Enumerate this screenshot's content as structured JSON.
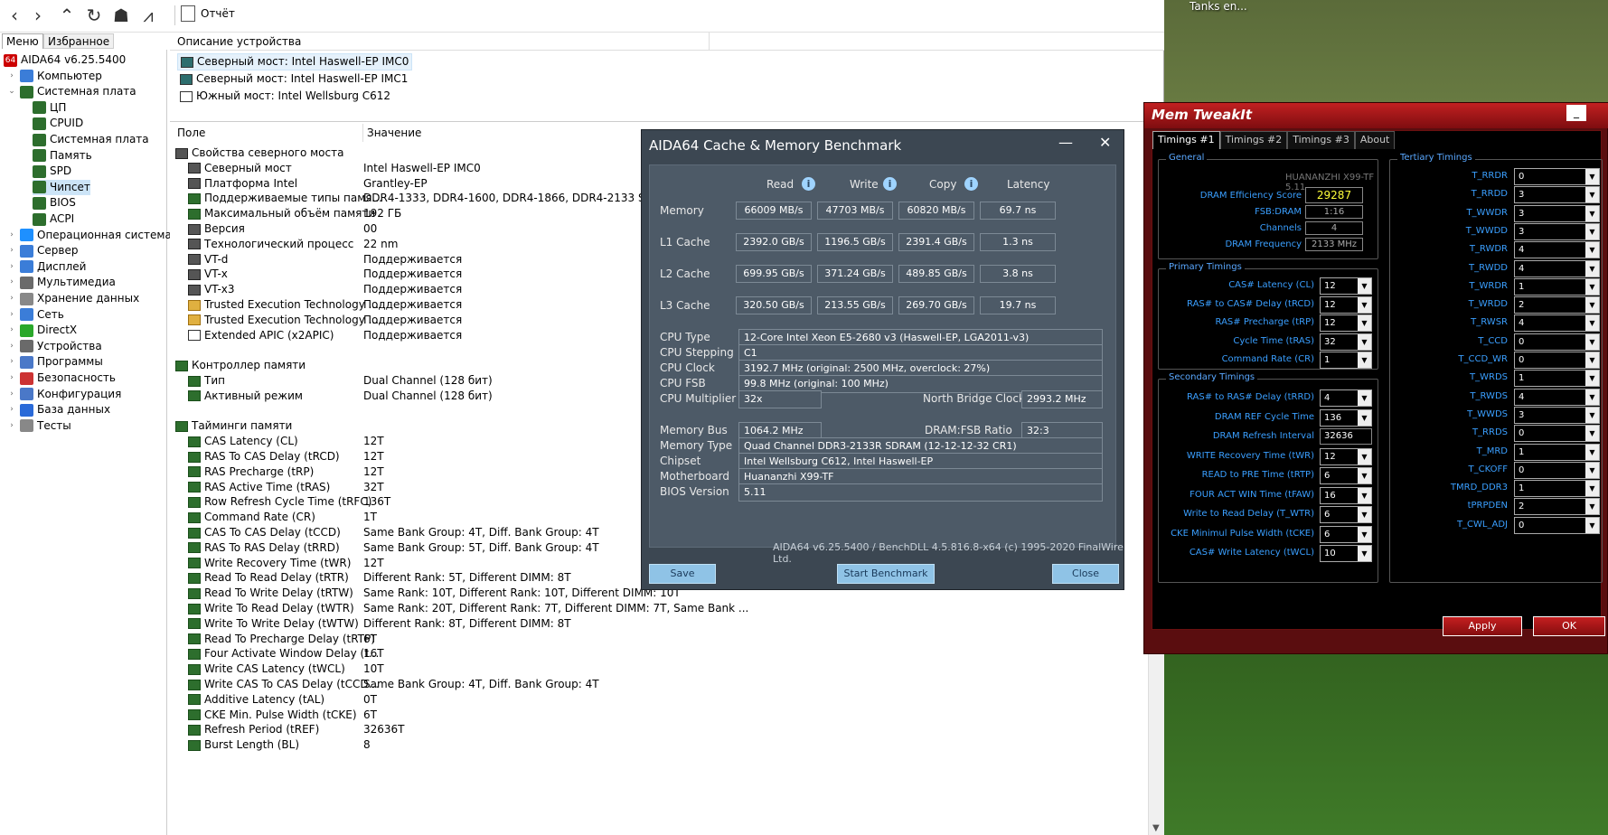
{
  "desktop": {
    "icon_label": "Tanks en..."
  },
  "toolbar": {
    "report_label": "Отчёт"
  },
  "tabs": {
    "menu": "Меню",
    "favorites": "Избранное"
  },
  "tree": [
    {
      "label": "AIDA64 v6.25.5400",
      "level": 0,
      "arrow": "",
      "icon": "aida64-icon"
    },
    {
      "label": "Компьютер",
      "level": 1,
      "arrow": "›",
      "icon": "computer-icon"
    },
    {
      "label": "Системная плата",
      "level": 1,
      "arrow": "⌄",
      "icon": "motherboard-icon"
    },
    {
      "label": "ЦП",
      "level": 2,
      "arrow": "",
      "icon": "cpu-icon"
    },
    {
      "label": "CPUID",
      "level": 2,
      "arrow": "",
      "icon": "cpuid-icon"
    },
    {
      "label": "Системная плата",
      "level": 2,
      "arrow": "",
      "icon": "board-icon"
    },
    {
      "label": "Память",
      "level": 2,
      "arrow": "",
      "icon": "memory-icon"
    },
    {
      "label": "SPD",
      "level": 2,
      "arrow": "",
      "icon": "spd-icon"
    },
    {
      "label": "Чипсет",
      "level": 2,
      "arrow": "",
      "icon": "chipset-icon",
      "selected": true
    },
    {
      "label": "BIOS",
      "level": 2,
      "arrow": "",
      "icon": "bios-icon"
    },
    {
      "label": "ACPI",
      "level": 2,
      "arrow": "",
      "icon": "acpi-icon"
    },
    {
      "label": "Операционная система",
      "level": 1,
      "arrow": "›",
      "icon": "os-icon"
    },
    {
      "label": "Сервер",
      "level": 1,
      "arrow": "›",
      "icon": "server-icon"
    },
    {
      "label": "Дисплей",
      "level": 1,
      "arrow": "›",
      "icon": "display-icon"
    },
    {
      "label": "Мультимедиа",
      "level": 1,
      "arrow": "›",
      "icon": "multimedia-icon"
    },
    {
      "label": "Хранение данных",
      "level": 1,
      "arrow": "›",
      "icon": "storage-icon"
    },
    {
      "label": "Сеть",
      "level": 1,
      "arrow": "›",
      "icon": "network-icon"
    },
    {
      "label": "DirectX",
      "level": 1,
      "arrow": "›",
      "icon": "directx-icon"
    },
    {
      "label": "Устройства",
      "level": 1,
      "arrow": "›",
      "icon": "devices-icon"
    },
    {
      "label": "Программы",
      "level": 1,
      "arrow": "›",
      "icon": "programs-icon"
    },
    {
      "label": "Безопасность",
      "level": 1,
      "arrow": "›",
      "icon": "security-icon"
    },
    {
      "label": "Конфигурация",
      "level": 1,
      "arrow": "›",
      "icon": "config-icon"
    },
    {
      "label": "База данных",
      "level": 1,
      "arrow": "›",
      "icon": "database-icon"
    },
    {
      "label": "Тесты",
      "level": 1,
      "arrow": "›",
      "icon": "tests-icon"
    }
  ],
  "device_header": "Описание устройства",
  "devices": [
    {
      "label": "Северный мост: Intel Haswell-EP IMC0",
      "selected": true
    },
    {
      "label": "Северный мост: Intel Haswell-EP IMC1"
    },
    {
      "label": "Южный мост: Intel Wellsburg C612"
    }
  ],
  "grid_headers": {
    "field": "Поле",
    "value": "Значение"
  },
  "rows": [
    {
      "field": "Свойства северного моста",
      "value": "",
      "group": true,
      "icon": "cpu"
    },
    {
      "field": "Северный мост",
      "value": "Intel Haswell-EP IMC0",
      "icon": "cpu"
    },
    {
      "field": "Платформа Intel",
      "value": "Grantley-EP",
      "icon": "cpu"
    },
    {
      "field": "Поддерживаемые типы памя...",
      "value": "DDR4-1333, DDR4-1600, DDR4-1866, DDR4-2133 SDRAM",
      "icon": "mem"
    },
    {
      "field": "Максимальный объём памяти",
      "value": "192 ГБ",
      "icon": "mem"
    },
    {
      "field": "Версия",
      "value": "00",
      "icon": "cpu"
    },
    {
      "field": "Технологический процесс",
      "value": "22 nm",
      "icon": "cpu"
    },
    {
      "field": "VT-d",
      "value": "Поддерживается",
      "icon": "cpu"
    },
    {
      "field": "VT-x",
      "value": "Поддерживается",
      "icon": "cpu"
    },
    {
      "field": "VT-x3",
      "value": "Поддерживается",
      "icon": "cpu"
    },
    {
      "field": "Trusted Execution Technology ...",
      "value": "Поддерживается",
      "icon": "lock"
    },
    {
      "field": "Trusted Execution Technology ...",
      "value": "Поддерживается",
      "icon": "lock"
    },
    {
      "field": "Extended APIC (x2APIC)",
      "value": "Поддерживается",
      "icon": "box"
    },
    {
      "field": "",
      "value": "",
      "spacer": true
    },
    {
      "field": "Контроллер памяти",
      "value": "",
      "group": true,
      "icon": "mem"
    },
    {
      "field": "Тип",
      "value": "Dual Channel  (128 бит)",
      "icon": "mem"
    },
    {
      "field": "Активный режим",
      "value": "Dual Channel  (128 бит)",
      "icon": "mem"
    },
    {
      "field": "",
      "value": "",
      "spacer": true
    },
    {
      "field": "Тайминги памяти",
      "value": "",
      "group": true,
      "icon": "mem"
    },
    {
      "field": "CAS Latency (CL)",
      "value": "12T",
      "icon": "mem"
    },
    {
      "field": "RAS To CAS Delay (tRCD)",
      "value": "12T",
      "icon": "mem"
    },
    {
      "field": "RAS Precharge (tRP)",
      "value": "12T",
      "icon": "mem"
    },
    {
      "field": "RAS Active Time (tRAS)",
      "value": "32T",
      "icon": "mem"
    },
    {
      "field": "Row Refresh Cycle Time (tRFC)",
      "value": "136T",
      "icon": "mem"
    },
    {
      "field": "Command Rate (CR)",
      "value": "1T",
      "icon": "mem"
    },
    {
      "field": "CAS To CAS Delay (tCCD)",
      "value": "Same Bank Group: 4T, Diff. Bank Group: 4T",
      "icon": "mem"
    },
    {
      "field": "RAS To RAS Delay (tRRD)",
      "value": "Same Bank Group: 5T, Diff. Bank Group: 4T",
      "icon": "mem"
    },
    {
      "field": "Write Recovery Time (tWR)",
      "value": "12T",
      "icon": "mem"
    },
    {
      "field": "Read To Read Delay (tRTR)",
      "value": "Different Rank: 5T, Different DIMM: 8T",
      "icon": "mem"
    },
    {
      "field": "Read To Write Delay (tRTW)",
      "value": "Same Rank: 10T, Different Rank: 10T, Different DIMM: 10T",
      "icon": "mem"
    },
    {
      "field": "Write To Read Delay (tWTR)",
      "value": "Same Rank: 20T, Different Rank: 7T, Different DIMM: 7T, Same Bank ...",
      "icon": "mem"
    },
    {
      "field": "Write To Write Delay (tWTW)",
      "value": "Different Rank: 8T, Different DIMM: 8T",
      "icon": "mem"
    },
    {
      "field": "Read To Precharge Delay (tRTP)",
      "value": "6T",
      "icon": "mem"
    },
    {
      "field": "Four Activate Window Delay (t...",
      "value": "16T",
      "icon": "mem"
    },
    {
      "field": "Write CAS Latency (tWCL)",
      "value": "10T",
      "icon": "mem"
    },
    {
      "field": "Write CAS To CAS Delay (tCCD...",
      "value": "Same Bank Group: 4T, Diff. Bank Group: 4T",
      "icon": "mem"
    },
    {
      "field": "Additive Latency (tAL)",
      "value": "0T",
      "icon": "mem"
    },
    {
      "field": "CKE Min. Pulse Width (tCKE)",
      "value": "6T",
      "icon": "mem"
    },
    {
      "field": "Refresh Period (tREF)",
      "value": "32636T",
      "icon": "mem"
    },
    {
      "field": "Burst Length (BL)",
      "value": "8",
      "icon": "mem"
    }
  ],
  "bench": {
    "title": "AIDA64 Cache & Memory Benchmark",
    "headers": {
      "read": "Read",
      "write": "Write",
      "copy": "Copy",
      "latency": "Latency"
    },
    "results": [
      {
        "label": "Memory",
        "read": "66009 MB/s",
        "write": "47703 MB/s",
        "copy": "60820 MB/s",
        "latency": "69.7 ns"
      },
      {
        "label": "L1 Cache",
        "read": "2392.0 GB/s",
        "write": "1196.5 GB/s",
        "copy": "2391.4 GB/s",
        "latency": "1.3 ns"
      },
      {
        "label": "L2 Cache",
        "read": "699.95 GB/s",
        "write": "371.24 GB/s",
        "copy": "489.85 GB/s",
        "latency": "3.8 ns"
      },
      {
        "label": "L3 Cache",
        "read": "320.50 GB/s",
        "write": "213.55 GB/s",
        "copy": "269.70 GB/s",
        "latency": "19.7 ns"
      }
    ],
    "cpu_type_label": "CPU Type",
    "cpu_type": "12-Core Intel Xeon E5-2680 v3  (Haswell-EP, LGA2011-v3)",
    "cpu_stepping_label": "CPU Stepping",
    "cpu_stepping": "C1",
    "cpu_clock_label": "CPU Clock",
    "cpu_clock": "3192.7 MHz  (original: 2500 MHz, overclock: 27%)",
    "cpu_fsb_label": "CPU FSB",
    "cpu_fsb": "99.8 MHz  (original: 100 MHz)",
    "cpu_mult_label": "CPU Multiplier",
    "cpu_mult": "32x",
    "nb_clock_label": "North Bridge Clock",
    "nb_clock": "2993.2 MHz",
    "mem_bus_label": "Memory Bus",
    "mem_bus": "1064.2 MHz",
    "dram_fsb_label": "DRAM:FSB Ratio",
    "dram_fsb": "32:3",
    "mem_type_label": "Memory Type",
    "mem_type": "Quad Channel DDR3-2133R SDRAM  (12-12-12-32 CR1)",
    "chipset_label": "Chipset",
    "chipset": "Intel Wellsburg C612, Intel Haswell-EP",
    "mobo_label": "Motherboard",
    "mobo": "Huananzhi X99-TF",
    "bios_label": "BIOS Version",
    "bios": "5.11",
    "footer": "AIDA64 v6.25.5400 / BenchDLL 4.5.816.8-x64  (c) 1995-2020 FinalWire Ltd.",
    "save": "Save",
    "start": "Start Benchmark",
    "close": "Close"
  },
  "mt": {
    "title": "Mem TweakIt",
    "tabs": [
      "Timings #1",
      "Timings #2",
      "Timings #3",
      "About"
    ],
    "general_title": "General",
    "model": "HUANANZHI X99-TF 5.11",
    "eff_label": "DRAM Efficiency Score",
    "eff": "29287",
    "fsb_label": "FSB:DRAM",
    "fsb": "1:16",
    "ch_label": "Channels",
    "ch": "4",
    "freq_label": "DRAM Frequency",
    "freq": "2133 MHz",
    "primary_title": "Primary Timings",
    "primary": [
      {
        "label": "CAS# Latency (CL)",
        "value": "12"
      },
      {
        "label": "RAS# to CAS# Delay (tRCD)",
        "value": "12"
      },
      {
        "label": "RAS# Precharge (tRP)",
        "value": "12"
      },
      {
        "label": "Cycle Time (tRAS)",
        "value": "32"
      },
      {
        "label": "Command Rate (CR)",
        "value": "1"
      }
    ],
    "secondary_title": "Secondary Timings",
    "secondary": [
      {
        "label": "RAS# to RAS# Delay (tRRD)",
        "value": "4",
        "combo": true
      },
      {
        "label": "DRAM REF Cycle Time",
        "value": "136",
        "combo": true
      },
      {
        "label": "DRAM Refresh Interval",
        "value": "32636",
        "combo": false
      },
      {
        "label": "WRITE Recovery Time (tWR)",
        "value": "12",
        "combo": true
      },
      {
        "label": "READ to PRE Time (tRTP)",
        "value": "6",
        "combo": true
      },
      {
        "label": "FOUR ACT WIN Time (tFAW)",
        "value": "16",
        "combo": true
      },
      {
        "label": "Write to Read Delay (T_WTR)",
        "value": "6",
        "combo": true
      },
      {
        "label": "CKE Minimul Pulse Width (tCKE)",
        "value": "6",
        "combo": true
      },
      {
        "label": "CAS# Write Latency (tWCL)",
        "value": "10",
        "combo": true
      }
    ],
    "tertiary_title": "Tertiary Timings",
    "tertiary": [
      {
        "label": "T_RRDR",
        "value": "0"
      },
      {
        "label": "T_RRDD",
        "value": "3"
      },
      {
        "label": "T_WWDR",
        "value": "3"
      },
      {
        "label": "T_WWDD",
        "value": "3"
      },
      {
        "label": "T_RWDR",
        "value": "4"
      },
      {
        "label": "T_RWDD",
        "value": "4"
      },
      {
        "label": "T_WRDR",
        "value": "1"
      },
      {
        "label": "T_WRDD",
        "value": "2"
      },
      {
        "label": "T_RWSR",
        "value": "4"
      },
      {
        "label": "T_CCD",
        "value": "0"
      },
      {
        "label": "T_CCD_WR",
        "value": "0"
      },
      {
        "label": "T_WRDS",
        "value": "1"
      },
      {
        "label": "T_RWDS",
        "value": "4"
      },
      {
        "label": "T_WWDS",
        "value": "3"
      },
      {
        "label": "T_RRDS",
        "value": "0"
      },
      {
        "label": "T_MRD",
        "value": "1"
      },
      {
        "label": "T_CKOFF",
        "value": "0"
      },
      {
        "label": "TMRD_DDR3",
        "value": "1"
      },
      {
        "label": "tPRPDEN",
        "value": "2"
      },
      {
        "label": "T_CWL_ADJ",
        "value": "0"
      }
    ],
    "apply": "Apply",
    "ok": "OK"
  }
}
